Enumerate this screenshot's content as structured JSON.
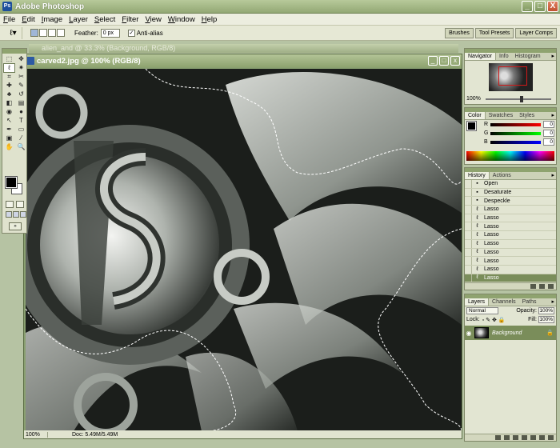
{
  "app": {
    "title": "Adobe Photoshop",
    "icon": "photoshop-app-icon",
    "window_buttons": [
      "_",
      "□",
      "X"
    ]
  },
  "menu": [
    "File",
    "Edit",
    "Image",
    "Layer",
    "Select",
    "Filter",
    "View",
    "Window",
    "Help"
  ],
  "options_bar": {
    "tool_icon": "lasso-icon",
    "feather_label": "Feather:",
    "feather_value": "0 px",
    "antialias_label": "Anti-alias",
    "antialias_checked": true,
    "palette_wells": [
      "Brushes",
      "Tool Presets",
      "Layer Comps"
    ]
  },
  "background_document": {
    "title": "alien_and @ 33.3% (Background, RGB/8)"
  },
  "document": {
    "title": "carved2.jpg @ 100% (RGB/8)",
    "zoom": "100%",
    "doc_size": "Doc: 5.49M/5.49M"
  },
  "tools": [
    "marquee",
    "move",
    "lasso",
    "magic-wand",
    "crop",
    "slice",
    "healing-brush",
    "brush",
    "clone-stamp",
    "history-brush",
    "eraser",
    "gradient",
    "blur",
    "dodge",
    "path-selection",
    "type",
    "pen",
    "shape",
    "notes",
    "eyedropper",
    "hand",
    "zoom"
  ],
  "tool_glyphs": [
    "⬚",
    "✥",
    "ℓ",
    "✷",
    "⌗",
    "✂",
    "✚",
    "✎",
    "♣",
    "↺",
    "◧",
    "▤",
    "◉",
    "●",
    "↖",
    "T",
    "✒",
    "▭",
    "▣",
    "⁄",
    "✋",
    "🔍"
  ],
  "active_tool": "lasso",
  "colors": {
    "foreground": "#000000",
    "background": "#ffffff",
    "selected_row": "#7a8d5a",
    "title_green": "#8ea36f"
  },
  "navigator": {
    "tabs": [
      "Navigator",
      "Info",
      "Histogram"
    ],
    "zoom": "100%"
  },
  "color_palette": {
    "tabs": [
      "Color",
      "Swatches",
      "Styles"
    ],
    "channels": [
      {
        "label": "R",
        "value": "0"
      },
      {
        "label": "G",
        "value": "0"
      },
      {
        "label": "B",
        "value": "0"
      }
    ]
  },
  "history": {
    "tabs": [
      "History",
      "Actions"
    ],
    "items": [
      "Open",
      "Desaturate",
      "Despeckle",
      "Lasso",
      "Lasso",
      "Lasso",
      "Lasso",
      "Lasso",
      "Lasso",
      "Lasso",
      "Lasso",
      "Lasso"
    ],
    "current_index": 11
  },
  "layers": {
    "tabs": [
      "Layers",
      "Channels",
      "Paths"
    ],
    "blend_mode": "Normal",
    "opacity_label": "Opacity:",
    "opacity": "100%",
    "lock_label": "Lock:",
    "fill_label": "Fill:",
    "fill": "100%",
    "items": [
      {
        "name": "Background",
        "visible": true,
        "locked": true
      }
    ]
  }
}
